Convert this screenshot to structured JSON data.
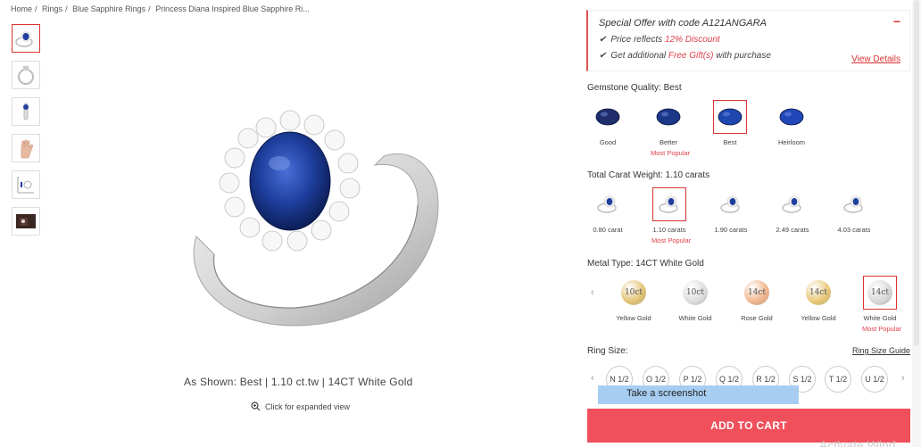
{
  "breadcrumb": [
    "Home",
    "Rings",
    "Blue Sapphire Rings",
    "Princess Diana Inspired Blue Sapphire Ri..."
  ],
  "thumbnails": [
    "ring-front-thumb",
    "ring-side-thumb",
    "ring-profile-thumb",
    "hand-thumb",
    "dimensions-thumb",
    "box-thumb"
  ],
  "main": {
    "as_shown": "As Shown: Best | 1.10 ct.tw | 14CT White Gold",
    "expand": "Click for expanded view"
  },
  "offer": {
    "prefix": "Special Offer",
    "mid": " with code ",
    "code": "A121ANGARA",
    "line1_pre": "Price reflects ",
    "line1_red": "12% Discount",
    "line2_pre": "Get additional ",
    "line2_red": "Free Gift(s)",
    "line2_post": " with purchase",
    "view": "View Details",
    "collapse": "−"
  },
  "gemstone": {
    "label": "Gemstone Quality: Best",
    "options": [
      {
        "name": "Good",
        "popular": ""
      },
      {
        "name": "Better",
        "popular": "Most Popular"
      },
      {
        "name": "Best",
        "popular": ""
      },
      {
        "name": "Heirloom",
        "popular": ""
      }
    ],
    "colors": [
      "#1f2d6b",
      "#1b3787",
      "#1e47b0",
      "#2146b8"
    ]
  },
  "carat": {
    "label": "Total Carat Weight: 1.10 carats",
    "options": [
      {
        "name": "0.80 carat",
        "popular": ""
      },
      {
        "name": "1.10 carats",
        "popular": "Most Popular"
      },
      {
        "name": "1.90 carats",
        "popular": ""
      },
      {
        "name": "2.49 carats",
        "popular": ""
      },
      {
        "name": "4.03 carats",
        "popular": ""
      }
    ]
  },
  "metal": {
    "label": "Metal Type: 14CT White Gold",
    "options": [
      {
        "name": "Yellow Gold",
        "code": "10ct",
        "popular": ""
      },
      {
        "name": "White Gold",
        "code": "10ct",
        "popular": ""
      },
      {
        "name": "Rose Gold",
        "code": "14ct",
        "popular": ""
      },
      {
        "name": "Yellow Gold",
        "code": "14ct",
        "popular": ""
      },
      {
        "name": "White Gold",
        "code": "14ct",
        "popular": "Most Popular"
      }
    ],
    "colors": [
      "#e2c271",
      "#dcdcdc",
      "#f0b48a",
      "#e8c774",
      "#d6d6d6"
    ]
  },
  "ring_size": {
    "label": "Ring Size:",
    "guide": "Ring Size Guide",
    "sizes": [
      "N 1/2",
      "O 1/2",
      "P 1/2",
      "Q 1/2",
      "R 1/2",
      "S 1/2",
      "T 1/2",
      "U 1/2"
    ]
  },
  "tooltip": "Take a screenshot",
  "cart": "ADD TO CART",
  "watermark": "Activate Wind",
  "colors": {
    "accent": "#f0505c",
    "sapphire": "#1e3f9e"
  }
}
